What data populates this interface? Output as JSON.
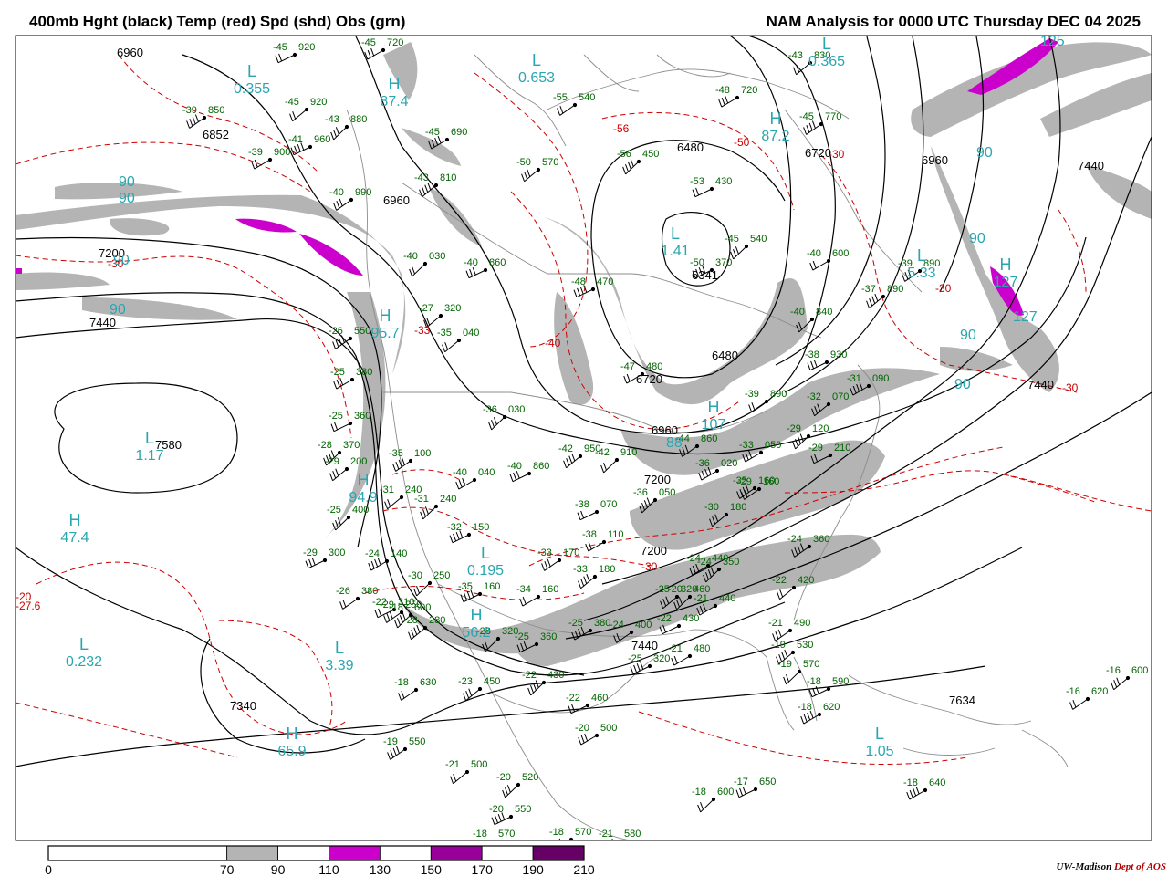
{
  "header": {
    "left_title": "400mb Hght (black) Temp (red) Spd (shd) Obs (grn)",
    "right_title": "NAM Analysis for 0000 UTC Thursday  DEC 04 2025"
  },
  "colors": {
    "height_contours": "#000000",
    "temperature_contours": "#cc0000",
    "observations": "#006400",
    "centers": "#2aa6b0",
    "speed_70_90": "#b4b4b4",
    "speed_110_130": "#cc00cc",
    "speed_150_170": "#990099",
    "speed_190_210": "#660066",
    "borders": "#8c8c8c"
  },
  "legend": {
    "labels": [
      "0",
      "70",
      "90",
      "110",
      "130",
      "150",
      "170",
      "190",
      "210"
    ],
    "segments": [
      {
        "from": 0,
        "to": 70,
        "color": "#ffffff"
      },
      {
        "from": 70,
        "to": 90,
        "color": "#b4b4b4"
      },
      {
        "from": 90,
        "to": 110,
        "color": "#ffffff"
      },
      {
        "from": 110,
        "to": 130,
        "color": "#cc00cc"
      },
      {
        "from": 130,
        "to": 150,
        "color": "#ffffff"
      },
      {
        "from": 150,
        "to": 170,
        "color": "#990099"
      },
      {
        "from": 170,
        "to": 190,
        "color": "#ffffff"
      },
      {
        "from": 190,
        "to": 210,
        "color": "#660066"
      }
    ]
  },
  "credit": {
    "org": "UW-Madison",
    "dept": "Dept of AOS"
  },
  "map": {
    "height_labels": [
      "6960",
      "6852",
      "6960",
      "7200",
      "7440",
      "6480",
      "6341",
      "6480",
      "6720",
      "6960",
      "7200",
      "7440",
      "7440",
      "6720",
      "6960",
      "7200",
      "7440",
      "7580",
      "7340",
      "7634"
    ],
    "temp_labels": [
      "-56",
      "-50",
      "-40",
      "-30",
      "-30",
      "-30",
      "-30",
      "-30",
      "-33",
      "-20",
      "-27.6"
    ],
    "centers": [
      {
        "letter": "L",
        "value": "0.355"
      },
      {
        "letter": "H",
        "value": "87.4"
      },
      {
        "letter": "L",
        "value": "0.653"
      },
      {
        "letter": "L",
        "value": "0.365"
      },
      {
        "letter": "H",
        "value": "87.2"
      },
      {
        "letter": "L",
        "value": "1.41"
      },
      {
        "letter": "L",
        "value": "5.33"
      },
      {
        "letter": "H",
        "value": "127"
      },
      {
        "letter": "H",
        "value": "95.7"
      },
      {
        "letter": "H",
        "value": "94.9"
      },
      {
        "letter": "H",
        "value": "47.4"
      },
      {
        "letter": "L",
        "value": "1.17"
      },
      {
        "letter": "L",
        "value": "0.195"
      },
      {
        "letter": "L",
        "value": "0.232"
      },
      {
        "letter": "L",
        "value": "3.39"
      },
      {
        "letter": "H",
        "value": "65.9"
      },
      {
        "letter": "L",
        "value": "1.05"
      },
      {
        "letter": "H",
        "value": "107"
      },
      {
        "letter": "H",
        "value": "56.2"
      }
    ],
    "speed_labels": [
      "90",
      "90",
      "90",
      "90",
      "90",
      "90",
      "90",
      "90",
      "125",
      "127",
      "88"
    ],
    "observations": [
      {
        "t": "-45",
        "h": "920"
      },
      {
        "t": "-45",
        "h": "720"
      },
      {
        "t": "-39",
        "h": "850"
      },
      {
        "t": "-45",
        "h": "920"
      },
      {
        "t": "-43",
        "h": "880"
      },
      {
        "t": "-41",
        "h": "960"
      },
      {
        "t": "-39",
        "h": "900"
      },
      {
        "t": "-40",
        "h": "990"
      },
      {
        "t": "-43",
        "h": "810"
      },
      {
        "t": "-40",
        "h": "030"
      },
      {
        "t": "-40",
        "h": "860"
      },
      {
        "t": "-45",
        "h": "690"
      },
      {
        "t": "-55",
        "h": "540"
      },
      {
        "t": "-50",
        "h": "570"
      },
      {
        "t": "-56",
        "h": "450"
      },
      {
        "t": "-53",
        "h": "430"
      },
      {
        "t": "-48",
        "h": "720"
      },
      {
        "t": "-45",
        "h": "770"
      },
      {
        "t": "-43",
        "h": "830"
      },
      {
        "t": "-45",
        "h": "540"
      },
      {
        "t": "-50",
        "h": "370"
      },
      {
        "t": "-40",
        "h": "600"
      },
      {
        "t": "-39",
        "h": "890"
      },
      {
        "t": "-37",
        "h": "890"
      },
      {
        "t": "-40",
        "h": "840"
      },
      {
        "t": "-38",
        "h": "930"
      },
      {
        "t": "-31",
        "h": "090"
      },
      {
        "t": "-39",
        "h": "890"
      },
      {
        "t": "-32",
        "h": "070"
      },
      {
        "t": "-29",
        "h": "120"
      },
      {
        "t": "-29",
        "h": "210"
      },
      {
        "t": "-33",
        "h": "050"
      },
      {
        "t": "-35",
        "h": "160"
      },
      {
        "t": "-35",
        "h": "040"
      },
      {
        "t": "-36",
        "h": "030"
      },
      {
        "t": "-48",
        "h": "470"
      },
      {
        "t": "-47",
        "h": "480"
      },
      {
        "t": "-44",
        "h": "860"
      },
      {
        "t": "-42",
        "h": "950"
      },
      {
        "t": "-42",
        "h": "910"
      },
      {
        "t": "-40",
        "h": "860"
      },
      {
        "t": "-36",
        "h": "020"
      },
      {
        "t": "-29",
        "h": "160"
      },
      {
        "t": "-30",
        "h": "180"
      },
      {
        "t": "-36",
        "h": "050"
      },
      {
        "t": "-38",
        "h": "070"
      },
      {
        "t": "-40",
        "h": "040"
      },
      {
        "t": "-35",
        "h": "100"
      },
      {
        "t": "-31",
        "h": "240"
      },
      {
        "t": "-31",
        "h": "240"
      },
      {
        "t": "-32",
        "h": "150"
      },
      {
        "t": "-38",
        "h": "110"
      },
      {
        "t": "-33",
        "h": "170"
      },
      {
        "t": "-33",
        "h": "180"
      },
      {
        "t": "-30",
        "h": "250"
      },
      {
        "t": "-29",
        "h": "300"
      },
      {
        "t": "-24",
        "h": "140"
      },
      {
        "t": "-26",
        "h": "380"
      },
      {
        "t": "-29",
        "h": "200"
      },
      {
        "t": "-28",
        "h": "370"
      },
      {
        "t": "-25",
        "h": "360"
      },
      {
        "t": "-25",
        "h": "380"
      },
      {
        "t": "-26",
        "h": "550"
      },
      {
        "t": "-27",
        "h": "320"
      },
      {
        "t": "-25",
        "h": "400"
      },
      {
        "t": "-35",
        "h": "160"
      },
      {
        "t": "-34",
        "h": "160"
      },
      {
        "t": "-29",
        "h": "250"
      },
      {
        "t": "-28",
        "h": "280"
      },
      {
        "t": "-28",
        "h": "320"
      },
      {
        "t": "-25",
        "h": "360"
      },
      {
        "t": "-25",
        "h": "380"
      },
      {
        "t": "-24",
        "h": "400"
      },
      {
        "t": "-25",
        "h": "320"
      },
      {
        "t": "-24",
        "h": "350"
      },
      {
        "t": "-22",
        "h": "430"
      },
      {
        "t": "-24",
        "h": "440"
      },
      {
        "t": "-24",
        "h": "360"
      },
      {
        "t": "-22",
        "h": "420"
      },
      {
        "t": "-20",
        "h": "460"
      },
      {
        "t": "-25",
        "h": "320"
      },
      {
        "t": "-21",
        "h": "480"
      },
      {
        "t": "-21",
        "h": "490"
      },
      {
        "t": "-19",
        "h": "530"
      },
      {
        "t": "-19",
        "h": "570"
      },
      {
        "t": "-18",
        "h": "590"
      },
      {
        "t": "-18",
        "h": "620"
      },
      {
        "t": "-18",
        "h": "630"
      },
      {
        "t": "-23",
        "h": "450"
      },
      {
        "t": "-22",
        "h": "430"
      },
      {
        "t": "-22",
        "h": "460"
      },
      {
        "t": "-20",
        "h": "500"
      },
      {
        "t": "-19",
        "h": "550"
      },
      {
        "t": "-21",
        "h": "500"
      },
      {
        "t": "-20",
        "h": "520"
      },
      {
        "t": "-20",
        "h": "550"
      },
      {
        "t": "-18",
        "h": "570"
      },
      {
        "t": "-18",
        "h": "570"
      },
      {
        "t": "-21",
        "h": "580"
      },
      {
        "t": "-18",
        "h": "600"
      },
      {
        "t": "-17",
        "h": "650"
      },
      {
        "t": "-18",
        "h": "640"
      },
      {
        "t": "-16",
        "h": "620"
      },
      {
        "t": "-16",
        "h": "600"
      },
      {
        "t": "-18",
        "h": "600"
      },
      {
        "t": "-22",
        "h": "310"
      },
      {
        "t": "-21",
        "h": "440"
      },
      {
        "t": "-26",
        "h": "440"
      }
    ]
  }
}
